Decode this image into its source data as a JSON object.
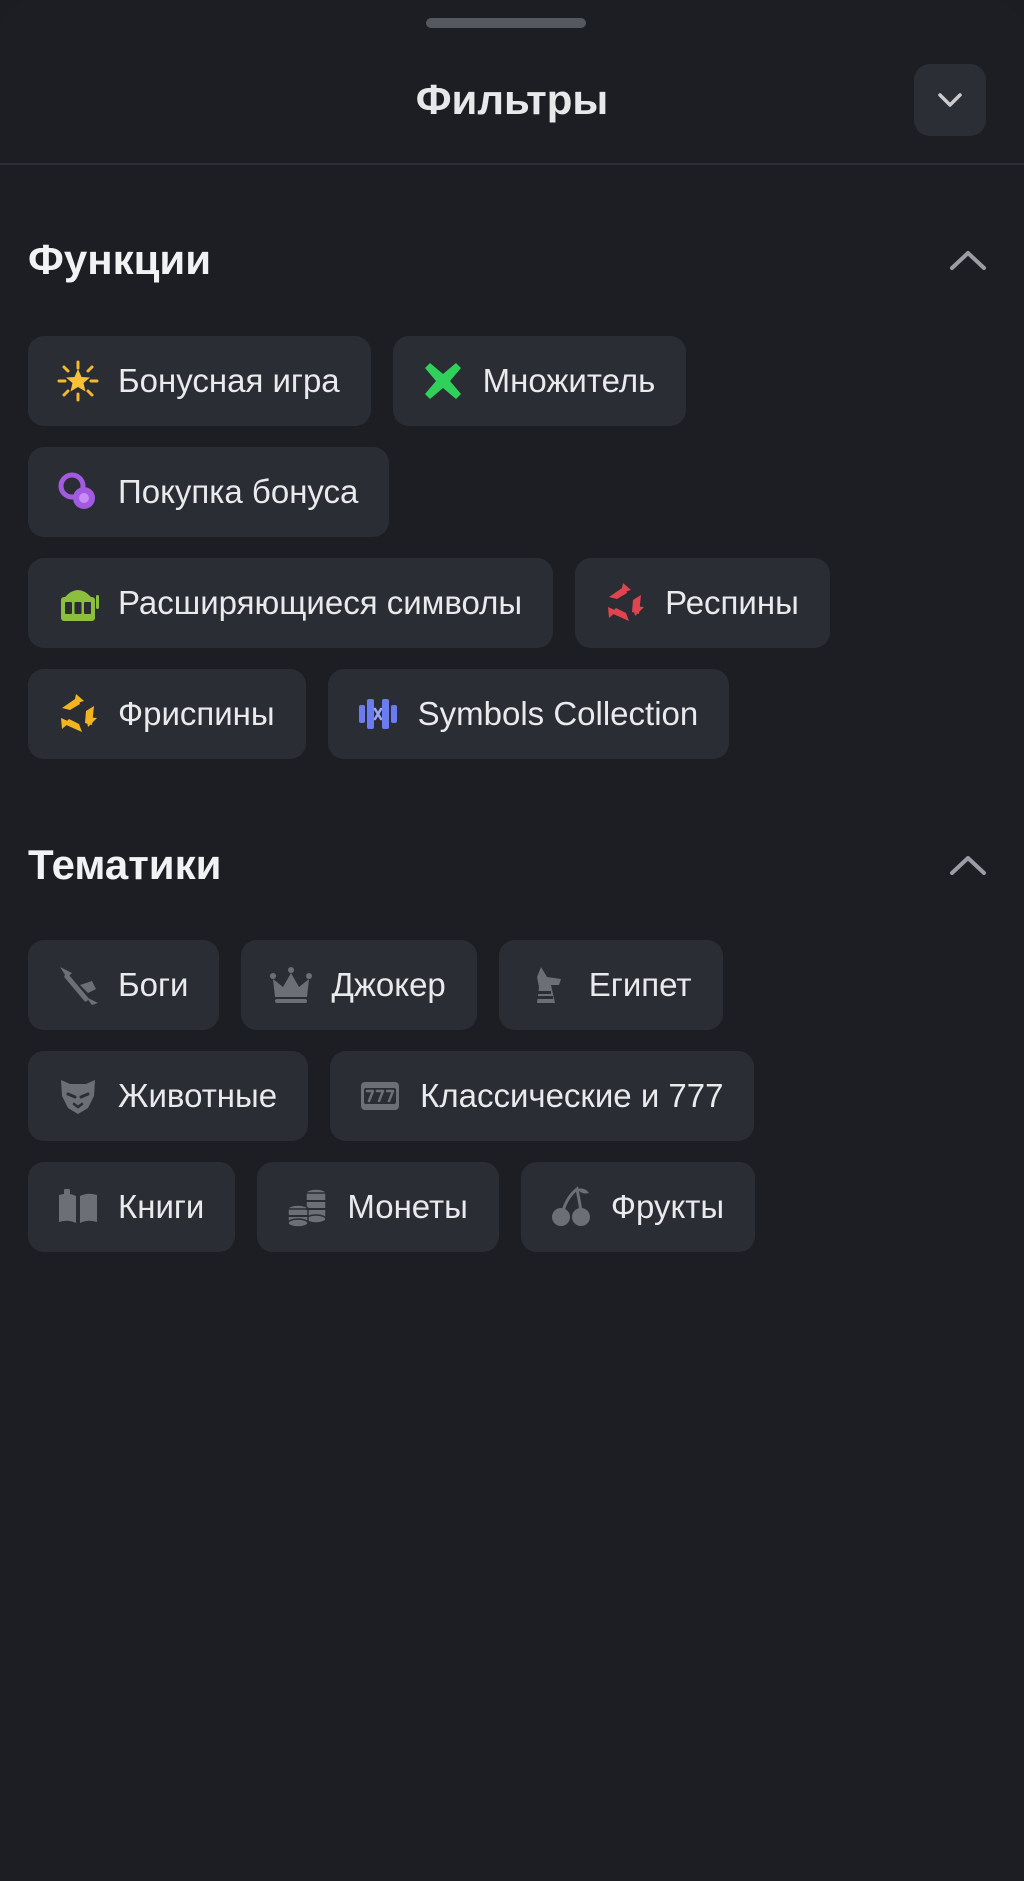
{
  "header": {
    "title": "Фильтры",
    "close_icon": "chevron-down-icon"
  },
  "colors": {
    "background": "#1c1e23",
    "chip_background": "#2a2d33",
    "text": "#e9eaec",
    "muted_icon": "#6c6f76"
  },
  "features": {
    "title": "Функции",
    "toggle_icon": "chevron-up-icon",
    "chips": [
      {
        "label": "Бонусная игра",
        "icon": "starburst-icon",
        "color": "#f5b82e"
      },
      {
        "label": "Множитель",
        "icon": "multiplier-x-icon",
        "color": "#2fd15a"
      },
      {
        "label": "Покупка бонуса",
        "icon": "linked-coins-icon",
        "color": "#a25be0"
      },
      {
        "label": "Расширяющиеся символы",
        "icon": "slot-machine-icon",
        "color": "#8bbf3d"
      },
      {
        "label": "Респины",
        "icon": "respin-arrows-icon",
        "color": "#e0454f"
      },
      {
        "label": "Фриспины",
        "icon": "freespin-arrows-icon",
        "color": "#f2b51f"
      },
      {
        "label": "Symbols Collection",
        "icon": "symbols-collection-icon",
        "color": "#6a7cf0"
      }
    ]
  },
  "themes": {
    "title": "Тематики",
    "toggle_icon": "chevron-up-icon",
    "chips": [
      {
        "label": "Боги",
        "icon": "trident-icon"
      },
      {
        "label": "Джокер",
        "icon": "jester-crown-icon"
      },
      {
        "label": "Египет",
        "icon": "anubis-icon"
      },
      {
        "label": "Животные",
        "icon": "panther-head-icon"
      },
      {
        "label": "Классические и 777",
        "icon": "seven-slot-icon"
      },
      {
        "label": "Книги",
        "icon": "open-book-icon"
      },
      {
        "label": "Монеты",
        "icon": "coin-stack-icon"
      },
      {
        "label": "Фрукты",
        "icon": "cherries-icon"
      }
    ]
  }
}
